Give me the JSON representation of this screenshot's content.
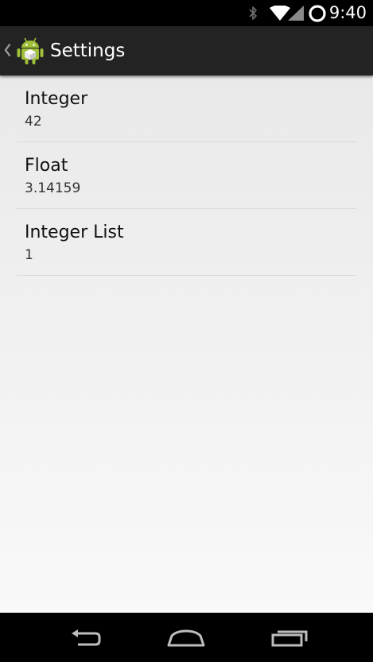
{
  "status_bar": {
    "time": "9:40",
    "icons": [
      "bluetooth-icon",
      "wifi-icon",
      "cell-signal-icon",
      "battery-icon"
    ]
  },
  "action_bar": {
    "title": "Settings",
    "icons": [
      "back-chevron-icon",
      "android-logo-icon"
    ]
  },
  "preferences": [
    {
      "title": "Integer",
      "summary": "42"
    },
    {
      "title": "Float",
      "summary": "3.14159"
    },
    {
      "title": "Integer List",
      "summary": "1"
    }
  ],
  "nav_bar": {
    "icons": [
      "back-icon",
      "home-icon",
      "recents-icon"
    ]
  },
  "colors": {
    "action_bar_bg": "#232323",
    "content_bg_top": "#e9e9e9",
    "content_bg_bottom": "#f9f9f9",
    "divider": "#d9d9d9",
    "android_green": "#9fc038"
  }
}
